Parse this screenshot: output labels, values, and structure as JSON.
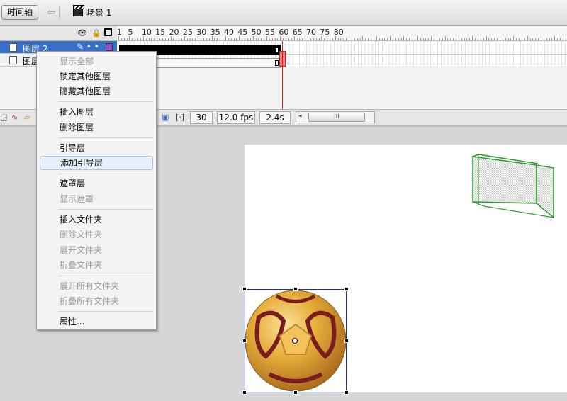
{
  "topbar": {
    "timeline_button": "时间轴",
    "back_icon": "left-arrow-icon",
    "scene_icon": "clapperboard-icon",
    "scene_label": "场景 1"
  },
  "timeline": {
    "header_icons": [
      "eye-icon",
      "lock-icon",
      "outline-square-icon"
    ],
    "ruler_labels": [
      "1",
      "5",
      "10",
      "15",
      "20",
      "25",
      "30",
      "35",
      "40",
      "45",
      "50",
      "55",
      "60",
      "65",
      "70",
      "75",
      "80"
    ],
    "layers": [
      {
        "name": "图层 2",
        "selected": true,
        "color": "#a24ac9"
      },
      {
        "name": "图层 1",
        "selected": false
      }
    ],
    "current_frame": "30",
    "fps": "12.0 fps",
    "time": "2.4s",
    "scrollbar_grip": "III"
  },
  "context_menu": {
    "items": [
      {
        "label": "显示全部",
        "disabled": true
      },
      {
        "label": "锁定其他图层",
        "disabled": false
      },
      {
        "label": "隐藏其他图层",
        "disabled": false
      },
      {
        "label": "插入图层",
        "disabled": false
      },
      {
        "label": "删除图层",
        "disabled": false
      },
      {
        "label": "引导层",
        "disabled": false
      },
      {
        "label": "添加引导层",
        "disabled": false,
        "hovered": true
      },
      {
        "label": "遮罩层",
        "disabled": false
      },
      {
        "label": "显示遮罩",
        "disabled": true
      },
      {
        "label": "插入文件夹",
        "disabled": false
      },
      {
        "label": "删除文件夹",
        "disabled": true
      },
      {
        "label": "展开文件夹",
        "disabled": true
      },
      {
        "label": "折叠文件夹",
        "disabled": true
      },
      {
        "label": "展开所有文件夹",
        "disabled": true
      },
      {
        "label": "折叠所有文件夹",
        "disabled": true
      },
      {
        "label": "属性...",
        "disabled": false
      }
    ]
  },
  "stage": {
    "objects": [
      "soccer-goal",
      "soccer-ball"
    ]
  }
}
